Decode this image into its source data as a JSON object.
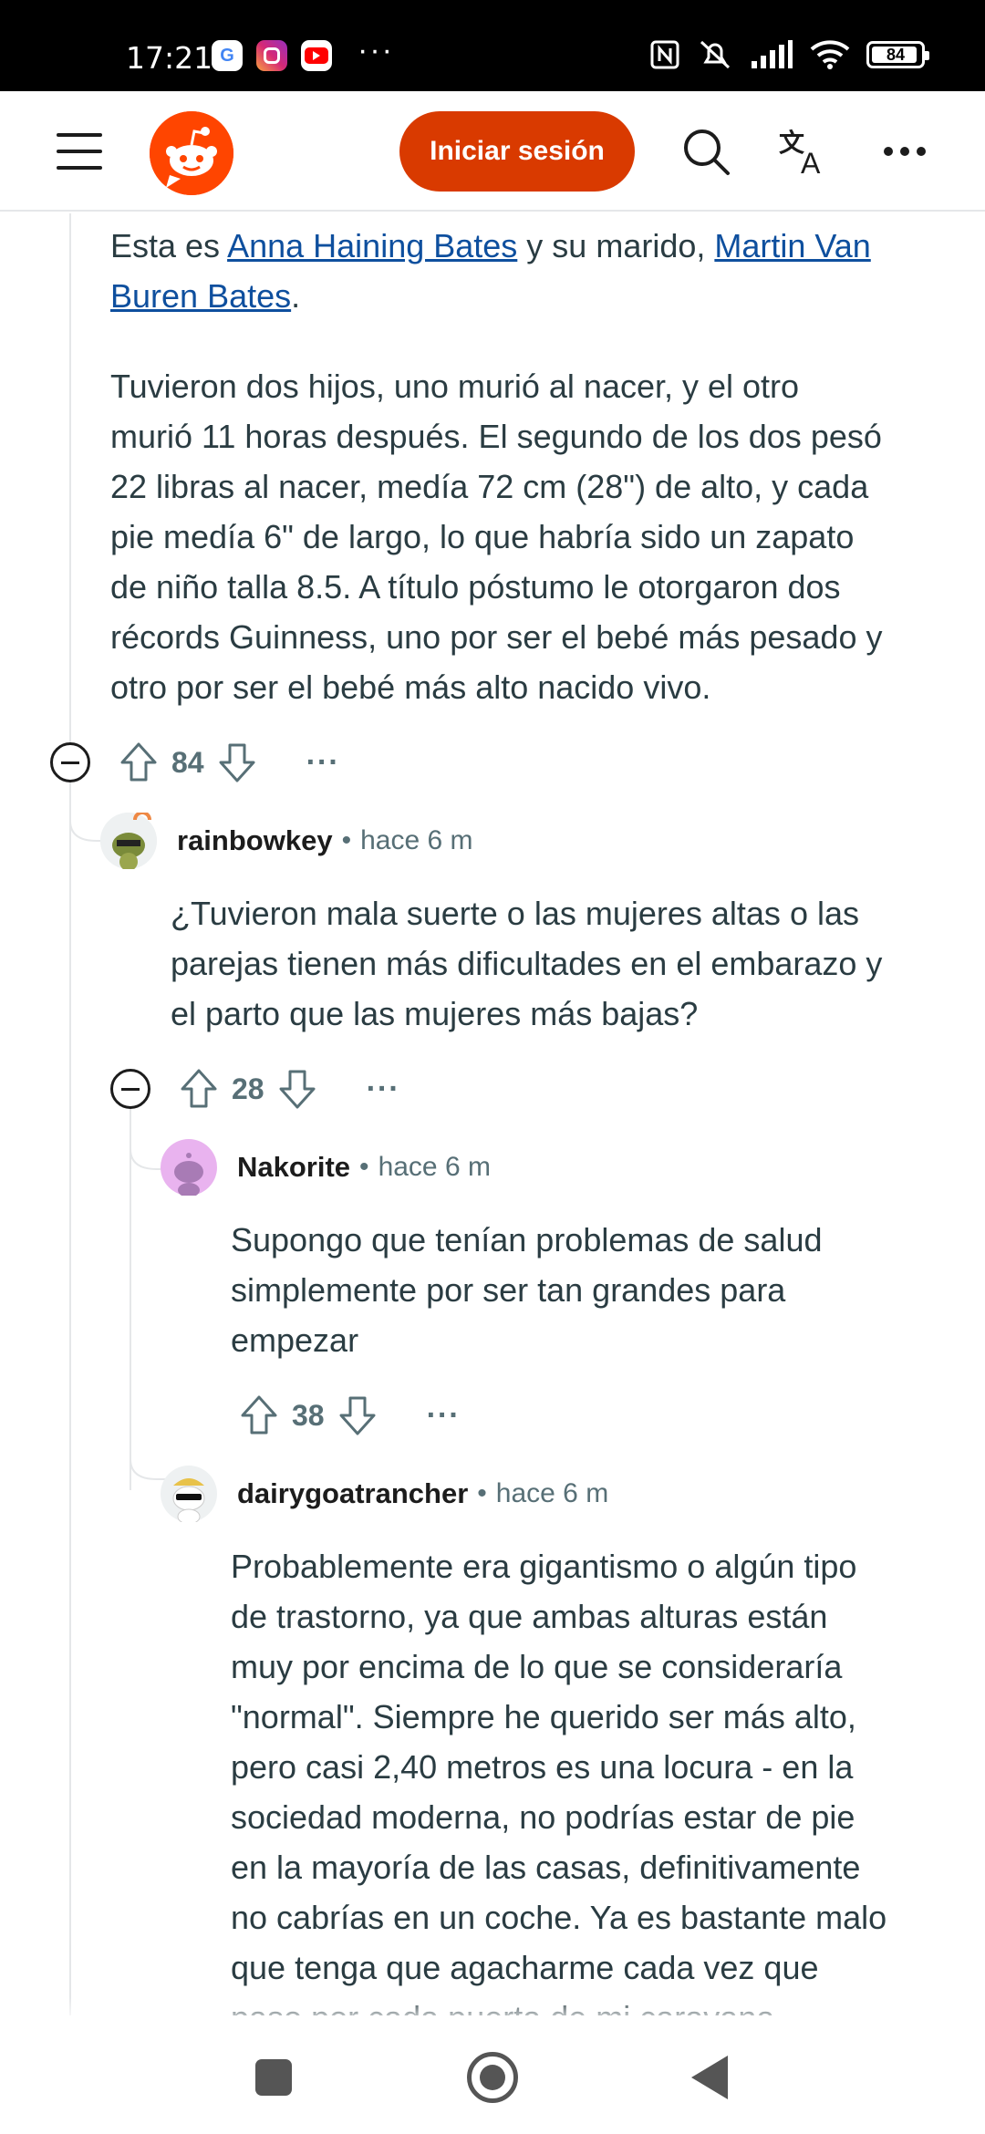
{
  "status_bar": {
    "time": "17:21",
    "apps": [
      "G",
      "instagram-icon",
      "youtube-icon"
    ],
    "more": "···",
    "battery": "84"
  },
  "header": {
    "login_label": "Iniciar sesión",
    "icons": [
      "menu-icon",
      "reddit-logo",
      "search-icon",
      "translate-icon",
      "more-icon"
    ]
  },
  "comments": {
    "top": {
      "line1_prefix": "Esta es ",
      "link1": "Anna Haining Bates",
      "line1_middle": " y su marido, ",
      "link2_part1": "Martin Van",
      "link2_part2": "Buren Bates",
      "line2_suffix": ".",
      "paragraph": "Tuvieron dos hijos, uno murió al nacer, y el otro\nmurió 11 horas después. El segundo de los dos pesó\n22 libras al nacer, medía 72 cm (28\") de alto, y cada\npie medía 6\" de largo, lo que habría sido un zapato\nde niño talla 8.5. A título póstumo le otorgaron dos\nrécords Guinness, uno por ser el bebé más pesado y\notro por ser el bebé más alto nacido vivo.",
      "votes": "84",
      "more": "···"
    },
    "c1": {
      "author": "rainbowkey",
      "time": "hace 6 m",
      "text": "¿Tuvieron mala suerte o las mujeres altas o las\nparejas tienen más dificultades en el embarazo y\nel parto que las mujeres más bajas?",
      "votes": "28",
      "more": "···"
    },
    "c2": {
      "author": "Nakorite",
      "time": "hace 6 m",
      "text": "Supongo que tenían problemas de salud\nsimplemente por ser tan grandes para\nempezar",
      "votes": "38",
      "more": "···"
    },
    "c3": {
      "author": "dairygoatrancher",
      "time": "hace 6 m",
      "text": "Probablemente era gigantismo o algún tipo\nde trastorno, ya que ambas alturas están\nmuy por encima de lo que se consideraría\n\"normal\". Siempre he querido ser más alto,\npero casi 2,40 metros es una locura - en la\nsociedad moderna, no podrías estar de pie\nen la mayoría de las casas, definitivamente\nno cabrías en un coche. Ya es bastante malo\nque tenga que agacharme cada vez que\npaso por cada puerta de mi caravana"
    },
    "separator": "•"
  },
  "colors": {
    "brand": "#ff4500",
    "login_button": "#d93a00",
    "link": "#0e4f9e",
    "meta": "#576f76"
  }
}
